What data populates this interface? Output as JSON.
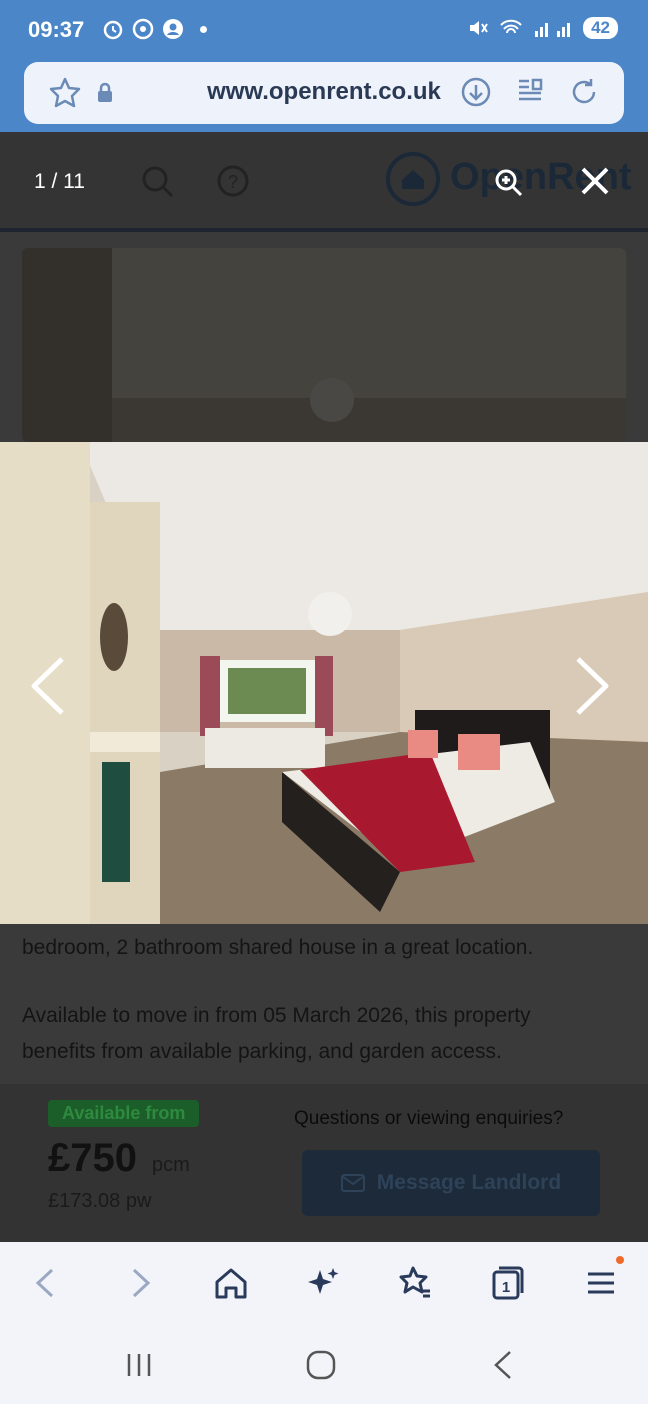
{
  "status_bar": {
    "time": "09:37",
    "battery": "42"
  },
  "browser": {
    "url": "www.openrent.co.uk"
  },
  "viewer": {
    "counter": "1 / 11",
    "brand": "OpenRent"
  },
  "listing": {
    "desc_line1": "bedroom, 2 bathroom shared house in a great location.",
    "desc_line2": "Available to move in from 05 March 2026, this property",
    "desc_line3": "benefits from available parking, and garden access.",
    "available_label": "Available from",
    "price": "£750",
    "price_unit": "pcm",
    "price_weekly": "£173.08 pw",
    "questions": "Questions or viewing enquiries?",
    "message_button": "Message Landlord"
  },
  "colors": {
    "status_bg": "#4b86c9",
    "accent_green": "#1b5e2a",
    "notification_dot": "#f06a2a"
  }
}
